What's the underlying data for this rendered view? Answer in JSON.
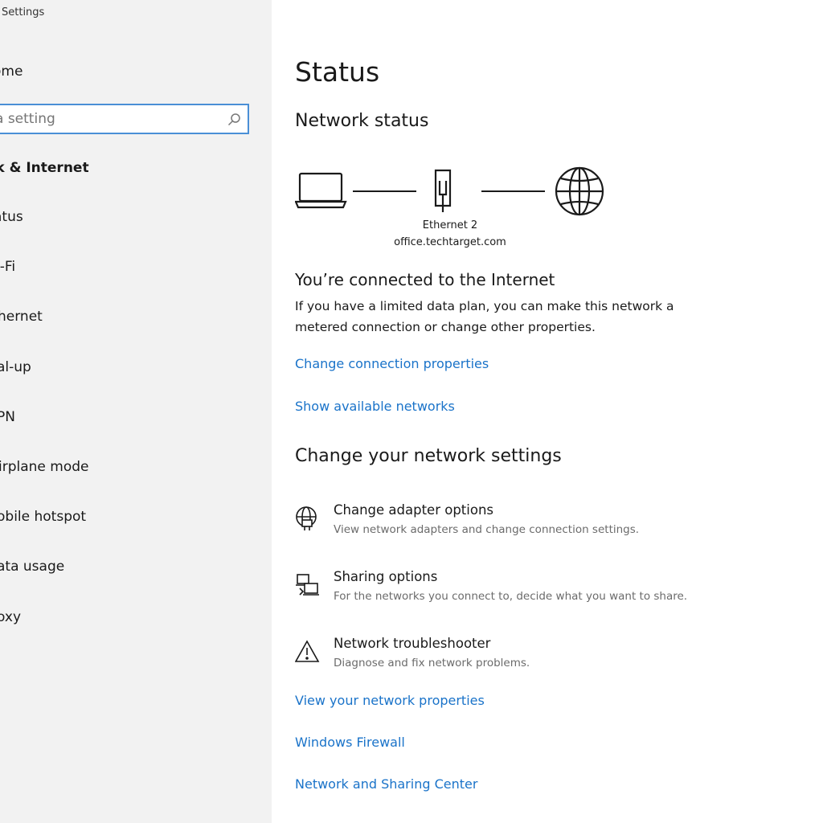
{
  "app": {
    "title": "Settings"
  },
  "sidebar": {
    "home_label": "ome",
    "search_placeholder": "a setting",
    "section_heading": "rk & Internet",
    "items": [
      {
        "label": "atus"
      },
      {
        "label": "i-Fi"
      },
      {
        "label": "hernet"
      },
      {
        "label": "al-up"
      },
      {
        "label": "PN"
      },
      {
        "label": "irplane mode"
      },
      {
        "label": "obile hotspot"
      },
      {
        "label": "ata usage"
      },
      {
        "label": "oxy"
      }
    ]
  },
  "main": {
    "title": "Status",
    "network_status_heading": "Network status",
    "diagram": {
      "adapter_name": "Ethernet 2",
      "network_name": "office.techtarget.com",
      "icons": [
        "laptop-icon",
        "ethernet-icon",
        "globe-icon"
      ]
    },
    "connected_title": "You’re connected to the Internet",
    "connected_desc": "If you have a limited data plan, you can make this network a metered connection or change other properties.",
    "links_top": [
      {
        "label": "Change connection properties"
      },
      {
        "label": "Show available networks"
      }
    ],
    "change_heading": "Change your network settings",
    "options": [
      {
        "icon": "adapter-globe-icon",
        "title": "Change adapter options",
        "desc": "View network adapters and change connection settings."
      },
      {
        "icon": "sharing-icon",
        "title": "Sharing options",
        "desc": "For the networks you connect to, decide what you want to share."
      },
      {
        "icon": "warning-icon",
        "title": "Network troubleshooter",
        "desc": "Diagnose and fix network problems."
      }
    ],
    "links_bottom": [
      {
        "label": "View your network properties"
      },
      {
        "label": "Windows Firewall"
      },
      {
        "label": "Network and Sharing Center"
      }
    ]
  },
  "colors": {
    "link": "#1a73c9",
    "search_border": "#4a8fd6",
    "sidebar_bg": "#f2f2f2"
  }
}
